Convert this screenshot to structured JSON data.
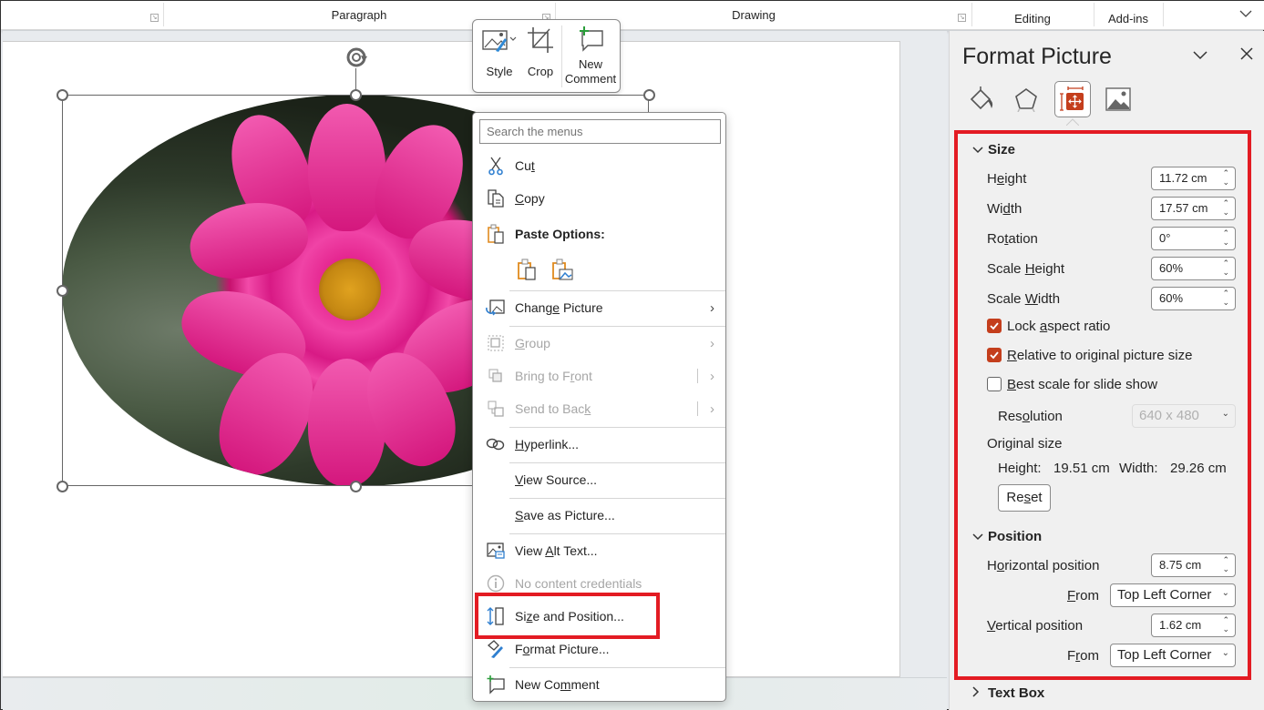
{
  "ribbon": {
    "groups": [
      {
        "label": "Paragraph"
      },
      {
        "label": "Drawing"
      },
      {
        "label": "Editing"
      },
      {
        "label": "Add-ins"
      }
    ],
    "collapse_icon": "chevron-down-icon"
  },
  "mini_toolbar": {
    "style_label": "Style",
    "crop_label": "Crop",
    "new_comment_line1": "New",
    "new_comment_line2": "Comment"
  },
  "context_menu": {
    "search_placeholder": "Search the menus",
    "items": [
      {
        "label_pre": "Cu",
        "label_u": "t",
        "label_post": "",
        "icon": "scissors-icon",
        "enabled": true
      },
      {
        "label_pre": "",
        "label_u": "C",
        "label_post": "opy",
        "icon": "copy-icon",
        "enabled": true
      },
      {
        "label": "Paste Options:",
        "icon": "paste-icon",
        "enabled": true
      },
      {
        "label_pre": "Chang",
        "label_u": "e",
        "label_post": " Picture",
        "icon": "change-picture-icon",
        "enabled": true,
        "submenu": true
      },
      {
        "label_pre": "",
        "label_u": "G",
        "label_post": "roup",
        "icon": "group-icon",
        "enabled": false,
        "submenu": true
      },
      {
        "label_pre": "Bring to F",
        "label_u": "r",
        "label_post": "ont",
        "icon": "bring-to-front-icon",
        "enabled": false,
        "submenu": true
      },
      {
        "label_pre": "Send to Bac",
        "label_u": "k",
        "label_post": "",
        "icon": "send-to-back-icon",
        "enabled": false,
        "submenu": true
      },
      {
        "label_pre": "",
        "label_u": "H",
        "label_post": "yperlink...",
        "icon": "link-icon",
        "enabled": true
      },
      {
        "label_pre": "",
        "label_u": "V",
        "label_post": "iew Source...",
        "enabled": true
      },
      {
        "label_pre": "",
        "label_u": "S",
        "label_post": "ave as Picture...",
        "enabled": true
      },
      {
        "label_pre": "View ",
        "label_u": "A",
        "label_post": "lt Text...",
        "icon": "alt-text-icon",
        "enabled": true
      },
      {
        "label": "No content credentials",
        "icon": "info-icon",
        "enabled": false
      },
      {
        "label_pre": "Si",
        "label_u": "z",
        "label_post": "e and Position...",
        "icon": "size-position-icon",
        "enabled": true,
        "highlighted": true
      },
      {
        "label_pre": "F",
        "label_u": "o",
        "label_post": "rmat Picture...",
        "icon": "format-picture-icon",
        "enabled": true
      },
      {
        "label_pre": "New Co",
        "label_u": "m",
        "label_post": "ment",
        "icon": "new-comment-icon",
        "enabled": true
      }
    ]
  },
  "format_pane": {
    "title": "Format Picture",
    "tabs": [
      "fill-line-icon",
      "effects-icon",
      "size-properties-icon",
      "picture-icon"
    ],
    "active_tab": 2,
    "size_section": {
      "title": "Size",
      "expanded": true,
      "height": {
        "label_pre": "H",
        "label_u": "e",
        "label_post": "ight",
        "value": "11.72 cm"
      },
      "width": {
        "label_pre": "Wi",
        "label_u": "d",
        "label_post": "th",
        "value": "17.57 cm"
      },
      "rotation": {
        "label_pre": "Ro",
        "label_u": "t",
        "label_post": "ation",
        "value": "0°"
      },
      "scale_height": {
        "label_pre": "Scale ",
        "label_u": "H",
        "label_post": "eight",
        "value": "60%"
      },
      "scale_width": {
        "label_pre": "Scale ",
        "label_u": "W",
        "label_post": "idth",
        "value": "60%"
      },
      "lock_aspect": {
        "label_pre": "Lock ",
        "label_u": "a",
        "label_post": "spect ratio",
        "checked": true
      },
      "relative_original": {
        "label_pre": "",
        "label_u": "R",
        "label_post": "elative to original picture size",
        "checked": true
      },
      "best_scale": {
        "label_pre": "",
        "label_u": "B",
        "label_post": "est scale for slide show",
        "checked": false
      },
      "resolution": {
        "label_pre": "Res",
        "label_u": "o",
        "label_post": "lution",
        "value": "640 x 480",
        "enabled": false
      },
      "original_size_label": "Original size",
      "original_height_label": "Height:",
      "original_height": "19.51 cm",
      "original_width_label": "Width:",
      "original_width": "29.26 cm",
      "reset": {
        "label_pre": "Re",
        "label_u": "s",
        "label_post": "et"
      }
    },
    "position_section": {
      "title": "Position",
      "expanded": true,
      "horizontal": {
        "label_pre": "H",
        "label_u": "o",
        "label_post": "rizontal position",
        "value": "8.75 cm"
      },
      "horizontal_from": {
        "label_pre": "",
        "label_u": "F",
        "label_post": "rom",
        "value": "Top Left Corner"
      },
      "vertical": {
        "label_pre": "",
        "label_u": "V",
        "label_post": "ertical position",
        "value": "1.62 cm"
      },
      "vertical_from": {
        "label_pre": "F",
        "label_u": "r",
        "label_post": "om",
        "value": "Top Left Corner"
      }
    },
    "text_box_section": {
      "title": "Text Box",
      "expanded": false
    }
  },
  "colors": {
    "accent": "#c43e1c",
    "highlight_red": "#e31b23"
  }
}
